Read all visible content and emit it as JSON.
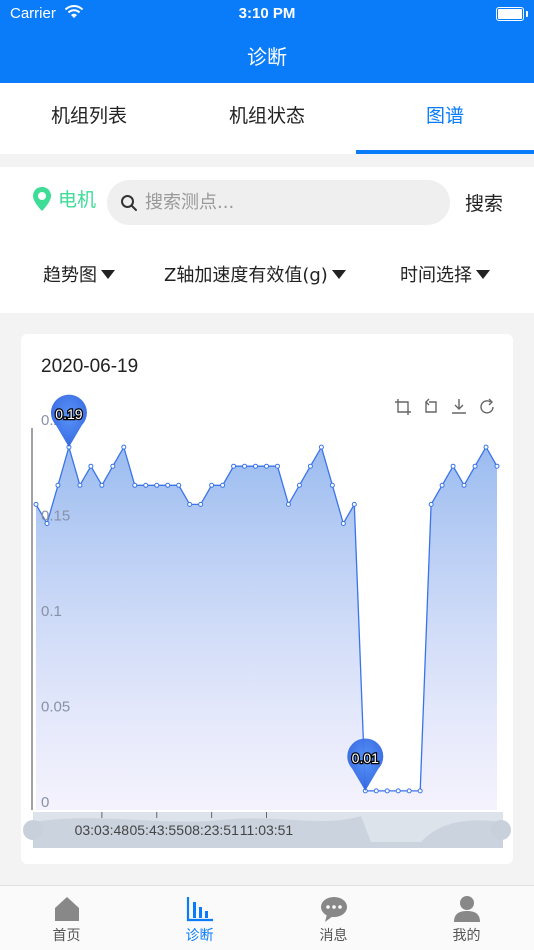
{
  "status_bar": {
    "carrier": "Carrier",
    "time": "3:10 PM"
  },
  "nav": {
    "title": "诊断"
  },
  "tabs": [
    {
      "label": "机组列表"
    },
    {
      "label": "机组状态"
    },
    {
      "label": "图谱"
    }
  ],
  "filter": {
    "location_label": "电机",
    "search_placeholder": "搜索测点...",
    "search_button": "搜索",
    "dropdowns": [
      {
        "label": "趋势图"
      },
      {
        "label": "Z轴加速度有效值(g)"
      },
      {
        "label": "时间选择"
      }
    ]
  },
  "card": {
    "date": "2020-06-19"
  },
  "colors": {
    "brand": "#0a7cfa",
    "location": "#3ddc97",
    "series_line": "#3a74e8",
    "marker": "#3b82f6"
  },
  "chart_data": {
    "type": "area",
    "ylim": [
      0,
      0.2
    ],
    "y_ticks": [
      "0",
      "0.05",
      "0.1",
      "0.15",
      "0.2"
    ],
    "x_tick_labels": [
      "03:03:48",
      "05:43:55",
      "08:23:51",
      "11:03:51"
    ],
    "x_tick_index": [
      6,
      11,
      16,
      21
    ],
    "series": [
      {
        "values": [
          0.16,
          0.15,
          0.17,
          0.19,
          0.17,
          0.18,
          0.17,
          0.18,
          0.19,
          0.17,
          0.17,
          0.17,
          0.17,
          0.17,
          0.16,
          0.16,
          0.17,
          0.17,
          0.18,
          0.18,
          0.18,
          0.18,
          0.18,
          0.16,
          0.17,
          0.18,
          0.19,
          0.17,
          0.15,
          0.16,
          0.01,
          0.01,
          0.01,
          0.01,
          0.01,
          0.01,
          0.16,
          0.17,
          0.18,
          0.17,
          0.18,
          0.19,
          0.18
        ]
      }
    ],
    "markers": [
      {
        "label": "0.19",
        "index": 3,
        "value": 0.19
      },
      {
        "label": "0.01",
        "index": 30,
        "value": 0.01
      }
    ]
  },
  "bottom_tabs": [
    {
      "label": "首页",
      "icon": "home-icon"
    },
    {
      "label": "诊断",
      "icon": "bar-chart-icon"
    },
    {
      "label": "消息",
      "icon": "message-icon"
    },
    {
      "label": "我的",
      "icon": "user-icon"
    }
  ]
}
